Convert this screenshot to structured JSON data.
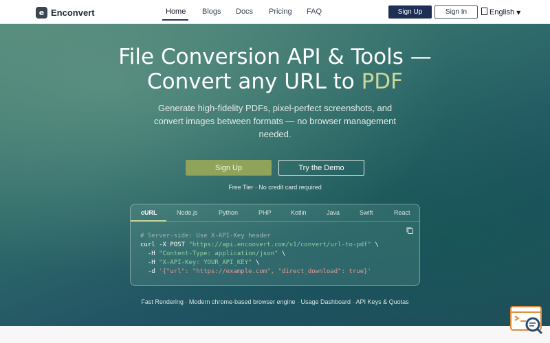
{
  "brand": {
    "name": "Enconvert",
    "mark": "e"
  },
  "nav": {
    "items": [
      {
        "label": "Home",
        "active": true
      },
      {
        "label": "Blogs",
        "active": false
      },
      {
        "label": "Docs",
        "active": false
      },
      {
        "label": "Pricing",
        "active": false
      },
      {
        "label": "FAQ",
        "active": false
      }
    ],
    "signup_label": "Sign Up",
    "signin_label": "Sign In",
    "language": "English",
    "language_icon": "globe-icon"
  },
  "hero": {
    "title_line1": "File Conversion API & Tools —",
    "title_line2_prefix": "Convert any URL to ",
    "title_highlight": "PDF",
    "subtitle": "Generate high-fidelity PDFs, pixel-perfect screenshots, and convert images between formats — no browser management needed.",
    "primary_button": "Sign Up",
    "secondary_button": "Try the Demo",
    "free_tier_note": "Free Tier · No credit card required"
  },
  "code_sample": {
    "tabs": [
      "cURL",
      "Node.js",
      "Python",
      "PHP",
      "Kotlin",
      "Java",
      "Swift",
      "React"
    ],
    "active_tab": "cURL",
    "copy_icon": "copy-icon",
    "lines": {
      "comment": "# Server-side: Use X-API-Key header",
      "line1_cmd": "curl -X POST ",
      "line1_url": "\"https://api.enconvert.com/v1/convert/url-to-pdf\"",
      "line1_tail": " \\",
      "line2_flag": "  -H ",
      "line2_val": "\"Content-Type: application/json\"",
      "line2_tail": " \\",
      "line3_flag": "  -H ",
      "line3_val": "\"X-API-Key: YOUR_API_KEY\"",
      "line3_tail": " \\",
      "line4_flag": "  -d ",
      "line4_val": "'{\"url\": \"https://example.com\", \"direct_download\": true}'"
    }
  },
  "features_line": "Fast Rendering · Modern chrome-based browser engine · Usage Dashboard · API Keys & Quotas",
  "colors": {
    "primary_dark": "#1e2f55",
    "accent_green": "#8fa35a",
    "highlight": "#c9d89a",
    "hero_teal": "#2e6a6a"
  }
}
